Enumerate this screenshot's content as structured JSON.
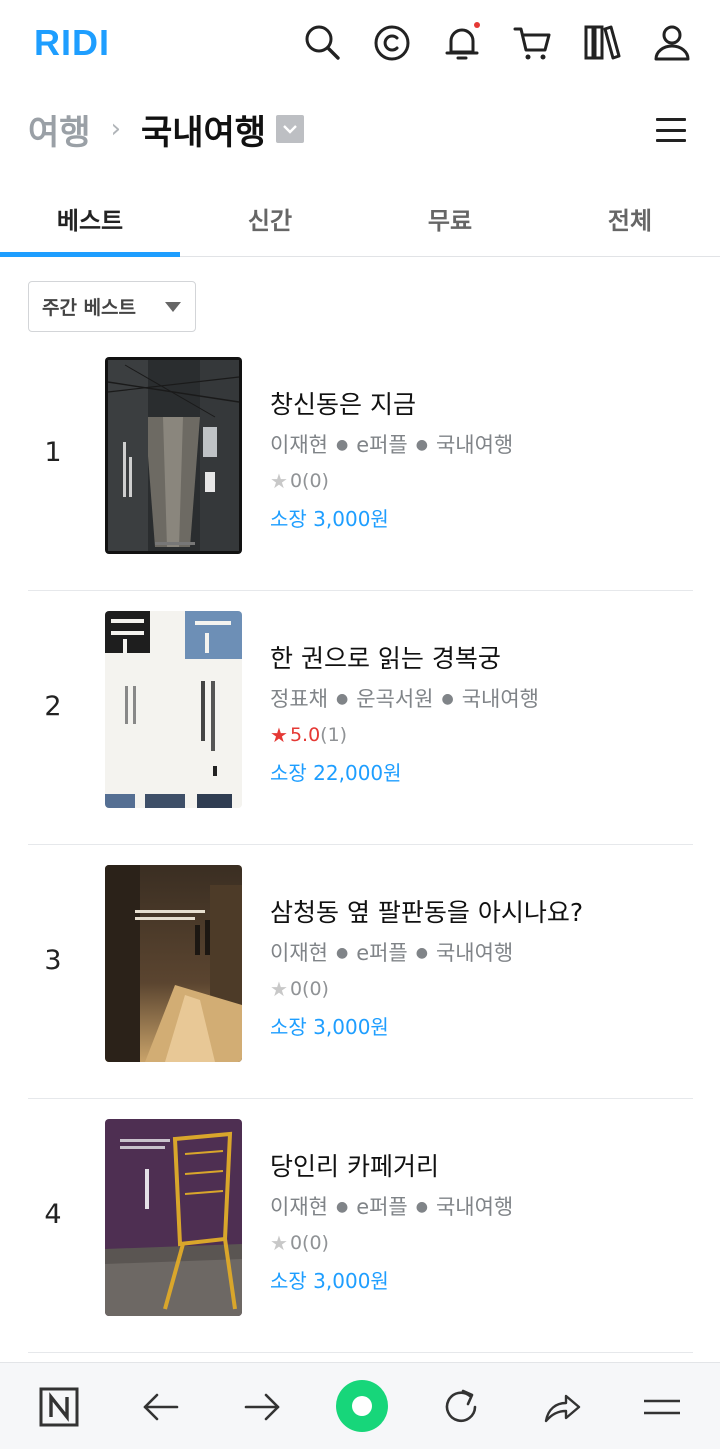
{
  "header": {
    "logo": "RIDI",
    "icons": [
      "search-icon",
      "cash-icon",
      "bell-icon",
      "cart-icon",
      "library-icon",
      "user-icon"
    ],
    "accent_color": "#1e9eff"
  },
  "breadcrumb": {
    "parent": "여행",
    "separator": "›",
    "current": "국내여행"
  },
  "tabs": [
    {
      "label": "베스트",
      "active": true
    },
    {
      "label": "신간",
      "active": false
    },
    {
      "label": "무료",
      "active": false
    },
    {
      "label": "전체",
      "active": false
    }
  ],
  "filter": {
    "selected": "주간 베스트"
  },
  "books": [
    {
      "rank": "1",
      "title": "창신동은 지금",
      "author": "이재현",
      "publisher": "e퍼플",
      "category": "국내여행",
      "score": "0",
      "count": "(0)",
      "rated": false,
      "price": "소장 3,000원"
    },
    {
      "rank": "2",
      "title": "한 권으로 읽는 경복궁",
      "author": "정표채",
      "publisher": "운곡서원",
      "category": "국내여행",
      "score": "5.0",
      "count": "(1)",
      "rated": true,
      "price": "소장 22,000원"
    },
    {
      "rank": "3",
      "title": "삼청동 옆 팔판동을 아시나요?",
      "author": "이재현",
      "publisher": "e퍼플",
      "category": "국내여행",
      "score": "0",
      "count": "(0)",
      "rated": false,
      "price": "소장 3,000원"
    },
    {
      "rank": "4",
      "title": "당인리 카페거리",
      "author": "이재현",
      "publisher": "e퍼플",
      "category": "국내여행",
      "score": "0",
      "count": "(0)",
      "rated": false,
      "price": "소장 3,000원"
    }
  ],
  "bottom_bar": {
    "icons": [
      "naver-n-icon",
      "back-arrow-icon",
      "forward-arrow-icon",
      "home-icon",
      "refresh-icon",
      "share-icon",
      "menu-icon"
    ],
    "home_color": "#17d67a"
  }
}
